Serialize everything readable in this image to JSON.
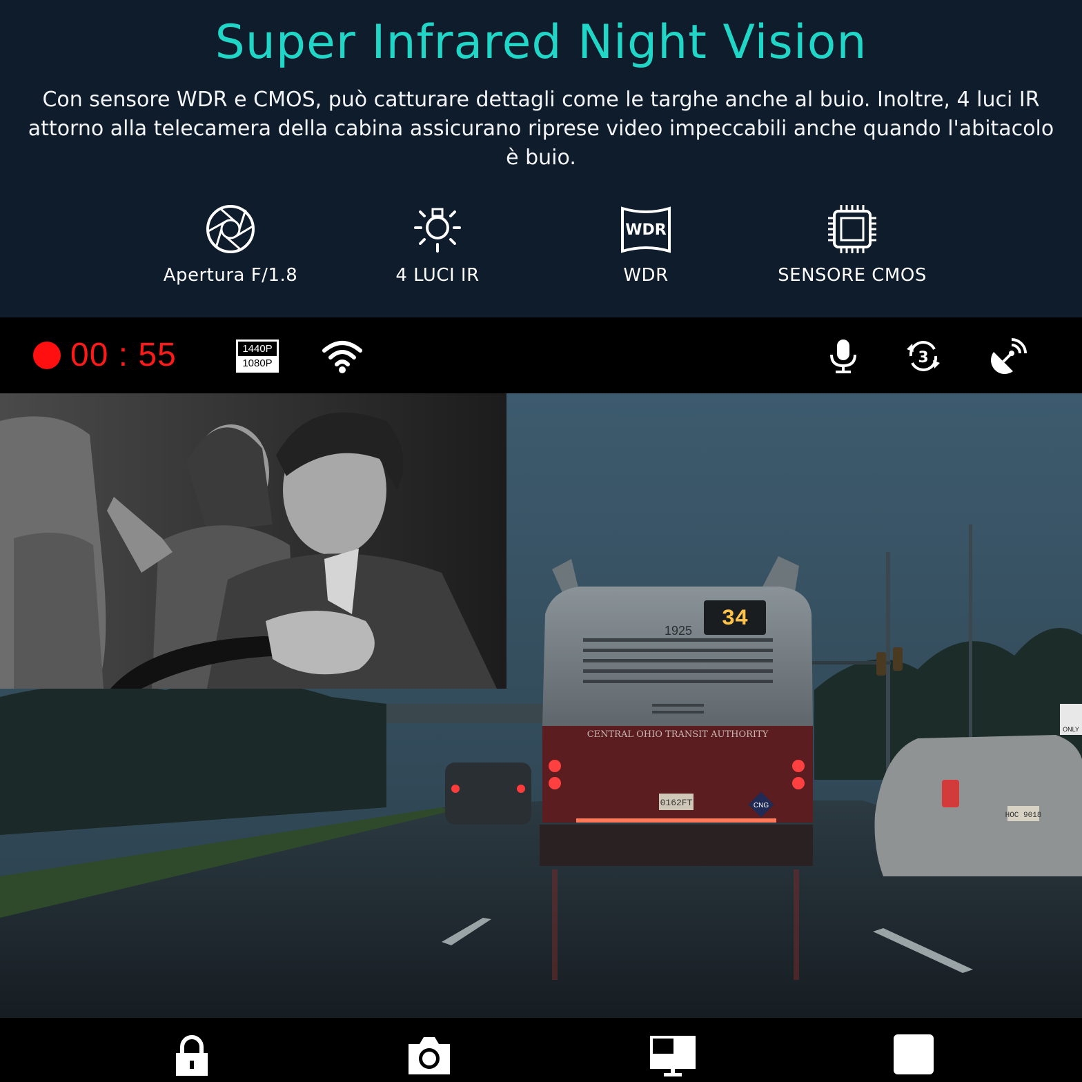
{
  "header": {
    "title": "Super Infrared Night Vision",
    "description": "Con sensore WDR e CMOS, può catturare dettagli come le targhe anche al buio. Inoltre, 4 luci IR attorno alla telecamera della cabina assicurano riprese video impeccabili anche quando l'abitacolo è buio."
  },
  "features": [
    {
      "icon": "aperture-icon",
      "label": "Apertura F/1.8"
    },
    {
      "icon": "ir-light-icon",
      "label": "4 LUCI IR"
    },
    {
      "icon": "wdr-icon",
      "label": "WDR",
      "badge_text": "WDR"
    },
    {
      "icon": "chip-icon",
      "label": "SENSORE CMOS"
    }
  ],
  "status_bar": {
    "recording_time": "00 : 55",
    "resolution_options": [
      "1440P",
      "1080P"
    ],
    "selected_resolution": "1080P",
    "loop_interval": "3",
    "icons": [
      "record-icon",
      "resolution-icon",
      "wifi-icon",
      "microphone-icon",
      "loop-recording-icon",
      "gps-icon"
    ]
  },
  "video_scene": {
    "bus_route": "34",
    "bus_number": "1925",
    "bus_operator": "CENTRAL OHIO TRANSIT AUTHORITY",
    "bus_plate": "0162FT",
    "bus_fuel_badge": "CNG",
    "car_plate": "HOC 9018",
    "road_sign": "ONLY"
  },
  "bottom_bar": {
    "icons": [
      "lock-icon",
      "camera-icon",
      "screen-mode-icon",
      "stop-icon"
    ]
  },
  "colors": {
    "accent_teal": "#1fd6c7",
    "panel_bg": "#0f1c2b",
    "recording_red": "#ff1a1a",
    "bar_black": "#000000"
  }
}
